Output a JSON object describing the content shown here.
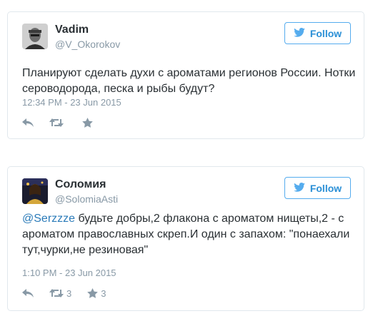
{
  "tweets": [
    {
      "display_name": "Vadim",
      "screen_name": "@V_Okorokov",
      "follow_label": "Follow",
      "text": "Планируют сделать духи с ароматами регионов России. Нотки сероводорода, песка и рыбы будут?",
      "timestamp": "12:34 PM - 23 Jun 2015",
      "retweet_count": "",
      "favorite_count": ""
    },
    {
      "display_name": "Соломия",
      "screen_name": "@SolomiaAsti",
      "follow_label": "Follow",
      "mention": "@Serzzze",
      "text": " будьте добры,2 флакона с ароматом нищеты,2 - с ароматом православных скреп.И один с запахом: \"понаехали тут,чурки,не резиновая\"",
      "timestamp": "1:10 PM - 23 Jun 2015",
      "retweet_count": "3",
      "favorite_count": "3"
    }
  ],
  "icons": {
    "follow": "twitter-bird-icon",
    "reply": "reply-icon",
    "retweet": "retweet-icon",
    "favorite": "star-icon"
  },
  "colors": {
    "accent": "#55acee",
    "link": "#2b7bb9",
    "muted": "#8899a6",
    "text": "#292f33",
    "border": "#e1e8ed"
  }
}
